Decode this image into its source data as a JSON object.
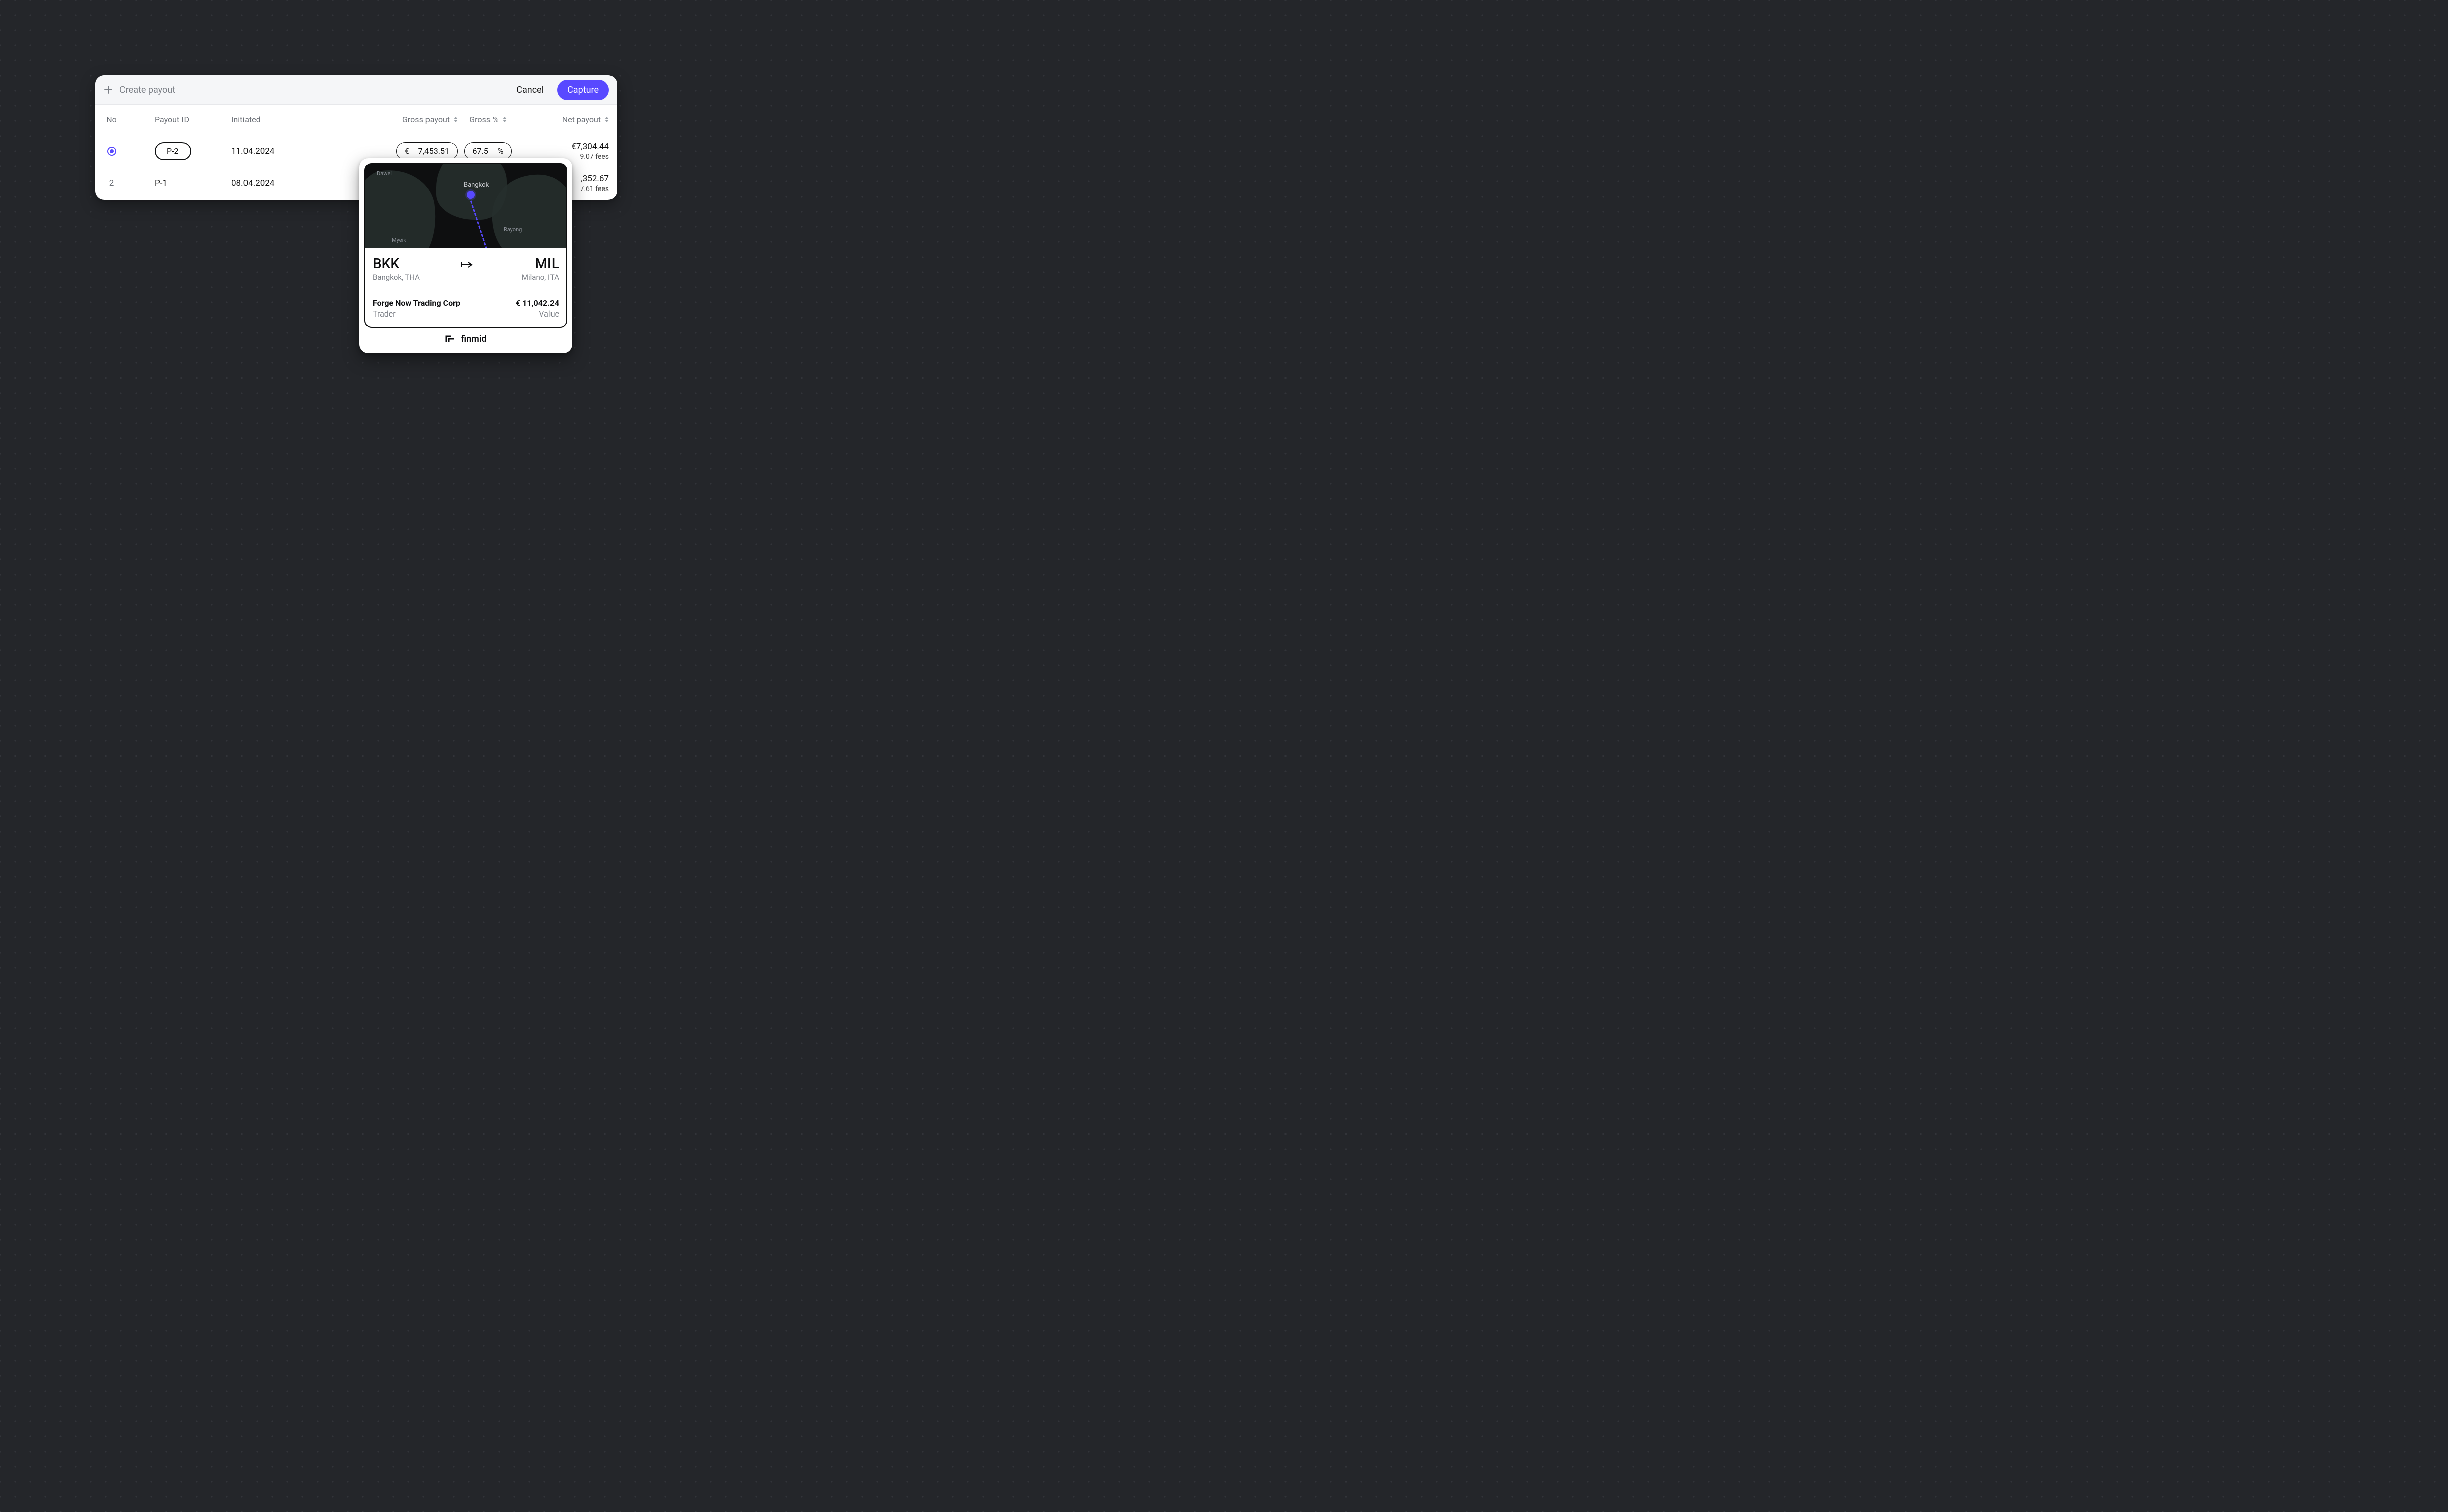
{
  "header": {
    "create_label": "Create payout",
    "cancel_label": "Cancel",
    "capture_label": "Capture"
  },
  "columns": {
    "no": "No",
    "payout_id": "Payout ID",
    "initiated": "Initiated",
    "gross_payout": "Gross payout",
    "gross_pct": "Gross %",
    "net_payout": "Net payout"
  },
  "rows": [
    {
      "selected": true,
      "status": "",
      "payout_id": "P-2",
      "initiated": "11.04.2024",
      "gross_currency": "€",
      "gross_amount": "7,453.51",
      "gross_pct_val": "67.5",
      "gross_pct_unit": "%",
      "net_amount": "€7,304.44",
      "net_fees_partial": "9.07 fees"
    },
    {
      "selected": false,
      "number": "2",
      "status": "green",
      "payout_id": "P-1",
      "initiated": "08.04.2024",
      "net_amount_partial": ",352.67",
      "net_fees_partial": "7.61 fees"
    }
  ],
  "map": {
    "labels": {
      "dawei": "Dawei",
      "bangkok": "Bangkok",
      "rayong": "Rayong",
      "myeik": "Myeik"
    },
    "origin_code": "BKK",
    "origin_city": "Bangkok, THA",
    "dest_code": "MIL",
    "dest_city": "Milano, ITA",
    "trader_name": "Forge Now Trading Corp",
    "trader_role": "Trader",
    "trade_value": "€ 11,042.24",
    "trade_value_caption": "Value"
  },
  "brand": "finmid"
}
